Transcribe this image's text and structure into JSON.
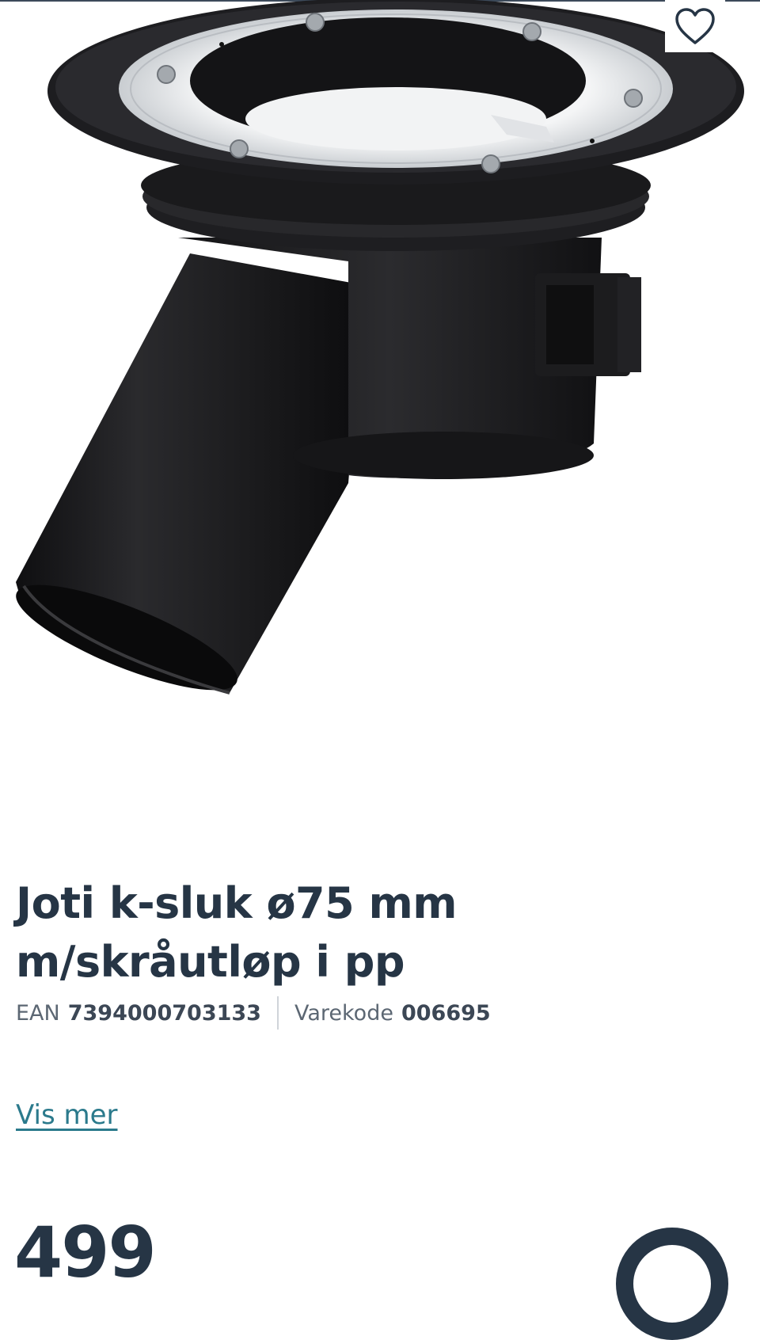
{
  "product": {
    "title": "Joti k-sluk ø75 mm m/skråutløp i pp",
    "ean_label": "EAN",
    "ean_value": "7394000703133",
    "sku_label": "Varekode",
    "sku_value": "006695",
    "image_alt": "Joti k-sluk ø75 mm m/skråutløp i pp"
  },
  "actions": {
    "show_more": "Vis mer"
  },
  "pricing": {
    "price": "499"
  },
  "icons": {
    "favorite": "heart-outline-icon"
  },
  "colors": {
    "text_dark": "#263545",
    "link": "#2b7a8c",
    "product_black": "#1b1b1d",
    "ring_silver": "#e6e8ea"
  }
}
